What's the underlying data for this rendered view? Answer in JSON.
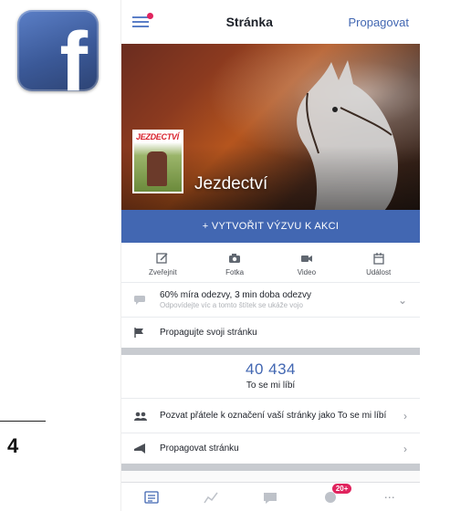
{
  "header": {
    "title": "Stránka",
    "promote_label": "Propagovat"
  },
  "cover": {
    "page_name": "Jezdectví",
    "profile_pic_text": "JEZDECTVÍ"
  },
  "cta": {
    "label": "+ VYTVOŘIT VÝZVU K AKCI"
  },
  "actions": [
    {
      "label": "Zveřejnit",
      "icon": "compose-icon"
    },
    {
      "label": "Fotka",
      "icon": "camera-icon"
    },
    {
      "label": "Video",
      "icon": "video-icon"
    },
    {
      "label": "Událost",
      "icon": "calendar-icon"
    }
  ],
  "response_row": {
    "main": "60% míra odezvy, 3 min doba odezvy",
    "sub": "Odpovídejte víc a tomto štítek se ukáže vojo"
  },
  "promote_page_row": {
    "label": "Propagujte svoji stránku"
  },
  "likes": {
    "count": "40 434",
    "label": "To se mi líbí"
  },
  "invite_row": {
    "label": "Pozvat přátele k označení vaší stránky jako To se mi líbí"
  },
  "promote_row": {
    "label": "Propagovat stránku"
  },
  "bottom_nav": {
    "notifications_badge": "20+"
  },
  "magazine": {
    "page_number": "4"
  },
  "colors": {
    "facebook_blue": "#4267b2",
    "badge_red": "#e0245e"
  }
}
